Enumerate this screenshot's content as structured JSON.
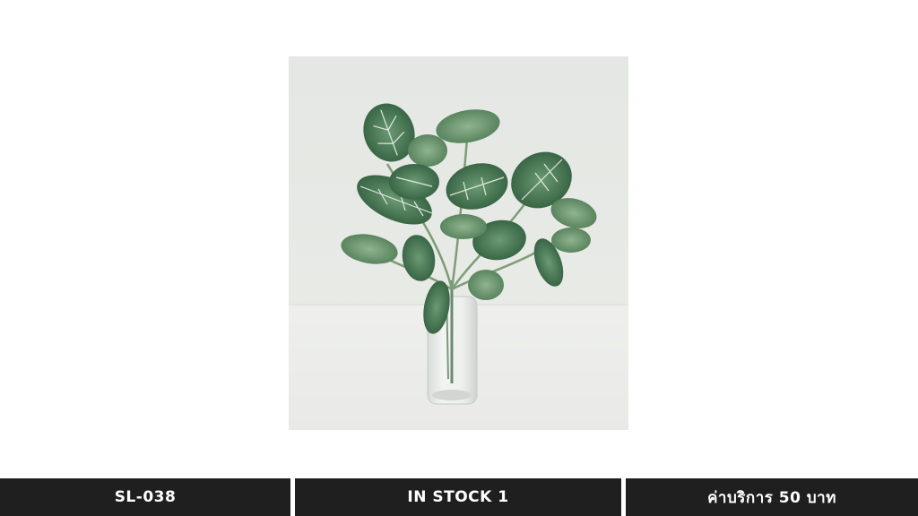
{
  "product": {
    "image_subject": "artificial fittonia leaf bouquet in clear glass vase"
  },
  "info_bar": {
    "sku": "SL-038",
    "stock": "IN STOCK 1",
    "service_fee": "ค่าบริการ 50 บาท"
  },
  "colors": {
    "bar_background": "#1f1f1f",
    "bar_text": "#ffffff",
    "photo_background": "#e6e8e5",
    "leaf_dark": "#2f5b3c",
    "leaf_mid": "#4f7b55",
    "leaf_vein": "#dfe9df"
  }
}
